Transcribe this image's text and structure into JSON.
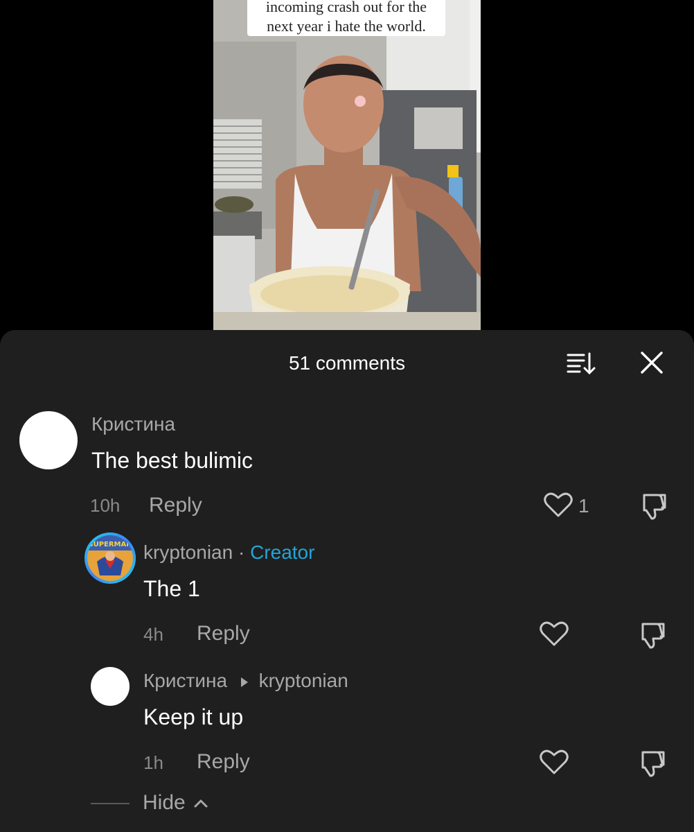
{
  "video": {
    "caption_line1": "incoming crash out for the",
    "caption_line2": "next year i hate the world."
  },
  "sheet": {
    "title": "51 comments",
    "sort_icon": "sort-icon",
    "close_icon": "close-icon"
  },
  "comments": [
    {
      "author": "Кристина",
      "text": "The best bulimic",
      "time": "10h",
      "reply_label": "Reply",
      "likes": "1"
    },
    {
      "author": "kryptonian",
      "separator": "·",
      "badge": "Creator",
      "text": "The 1",
      "time": "4h",
      "reply_label": "Reply",
      "avatar_label": "SUPERMAN"
    },
    {
      "author": "Кристина",
      "reply_to": "kryptonian",
      "text": "Keep it up",
      "time": "1h",
      "reply_label": "Reply"
    }
  ],
  "hide_label": "Hide",
  "colors": {
    "sheet_bg": "#1f1f1f",
    "creator_badge": "#22a5d6",
    "text_primary": "#ffffff",
    "text_secondary": "#a8a8a8"
  }
}
